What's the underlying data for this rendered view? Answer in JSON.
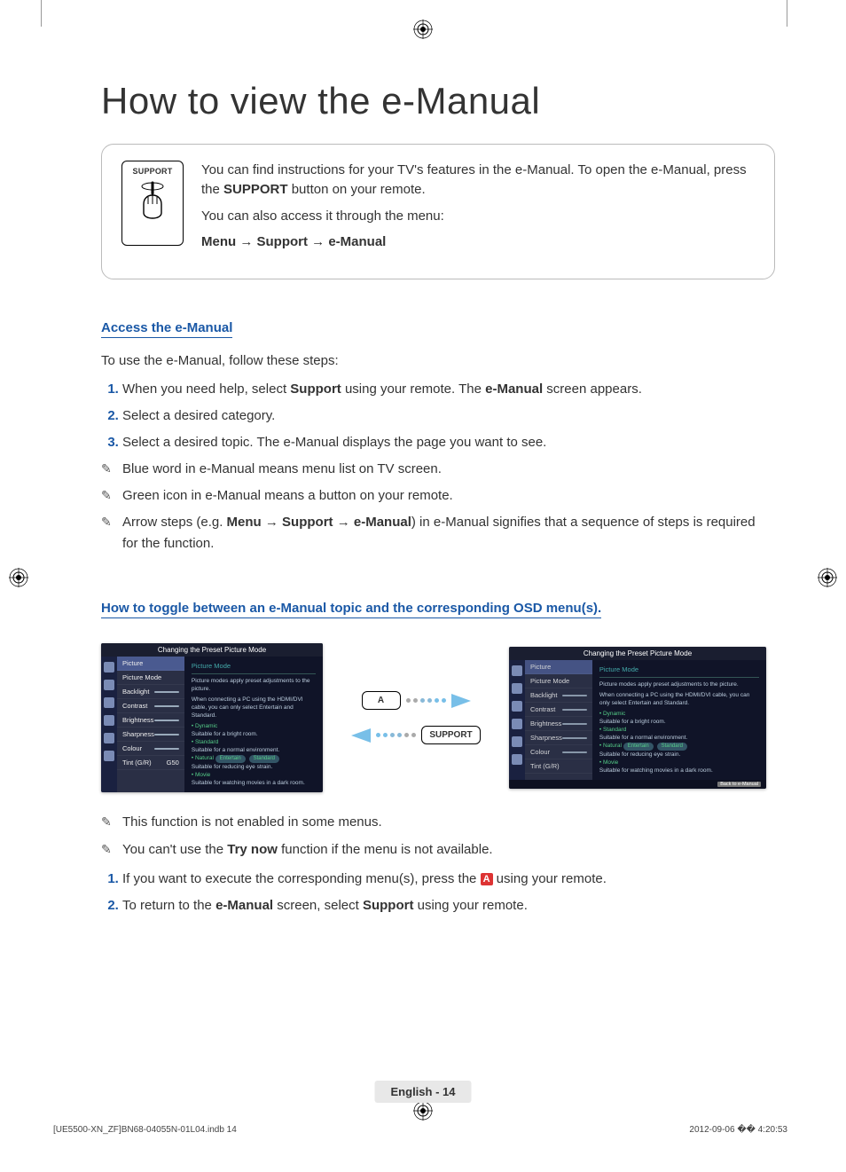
{
  "page": {
    "title": "How to view the e-Manual",
    "lang_footer": "English - 14",
    "doc_footer_left": "[UE5500-XN_ZF]BN68-04055N-01L04.indb   14",
    "doc_footer_right": "2012-09-06   �� 4:20:53"
  },
  "infobox": {
    "remote_button_label": "SUPPORT",
    "p1_a": "You can find instructions for your TV's features in the e-Manual. To open the e-Manual, press the ",
    "p1_b": "SUPPORT",
    "p1_c": " button on your remote.",
    "p2": "You can also access it through the menu:",
    "path": "Menu → Support → e-Manual"
  },
  "access": {
    "heading": "Access the e-Manual",
    "intro": "To use the e-Manual, follow these steps:",
    "step1_a": "When you need help, select ",
    "step1_b": "Support",
    "step1_c": " using your remote. The ",
    "step1_d": "e-Manual",
    "step1_e": " screen appears.",
    "step2": "Select a desired category.",
    "step3": "Select a desired topic. The e-Manual displays the page you want to see.",
    "note1": "Blue word in e-Manual means menu list on TV screen.",
    "note2": "Green icon in e-Manual means a button on your remote.",
    "note3_a": "Arrow steps (e.g. ",
    "note3_b": "Menu → Support → e-Manual",
    "note3_c": ") in e-Manual signifies that a sequence of steps is required for the function."
  },
  "toggle": {
    "heading": "How to toggle between an e-Manual topic and the corresponding OSD menu(s).",
    "key_a": "A",
    "key_support": "SUPPORT",
    "note1": "This function is not enabled in some menus.",
    "note2_a": "You can't use the ",
    "note2_b": "Try now",
    "note2_c": " function if the menu is not available.",
    "step1_a": "If you want to execute the corresponding menu(s), press the ",
    "step1_key": "A",
    "step1_b": " using your remote.",
    "step2_a": "To return to the ",
    "step2_b": "e-Manual",
    "step2_c": " screen, select ",
    "step2_d": "Support",
    "step2_e": " using your remote."
  },
  "tv": {
    "header": "Changing the Preset Picture Mode",
    "content_title": "Picture Mode",
    "menu": {
      "i0": "Picture",
      "i1": "Picture Mode",
      "i2": "Backlight",
      "i3": "Contrast",
      "i4": "Brightness",
      "i5": "Sharpness",
      "i6": "Colour",
      "i7": "Tint (G/R)",
      "tint_val": "G50"
    },
    "back_label": "Back to e-Manual",
    "desc1": "Picture modes apply preset adjustments to the picture.",
    "desc2": "When connecting a PC using the HDMI/DVI cable, you can only select Entertain and Standard.",
    "m_dynamic": "Dynamic",
    "m_dynamic_d": "Suitable for a bright room.",
    "m_standard": "Standard",
    "m_standard_d": "Suitable for a normal environment.",
    "m_natural": "Natural",
    "m_natural_d": "Suitable for reducing eye strain.",
    "m_movie": "Movie",
    "m_movie_d": "Suitable for watching movies in a dark room.",
    "pill_entertain": "Entertain",
    "pill_standard": "Standard"
  }
}
